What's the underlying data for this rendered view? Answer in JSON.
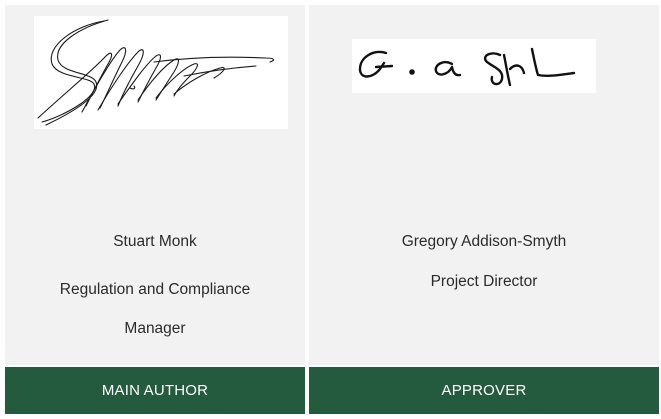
{
  "author": {
    "name": "Stuart Monk",
    "title": "Regulation and Compliance Manager",
    "role_label": "MAIN AUTHOR"
  },
  "approver": {
    "name": "Gregory Addison-Smyth",
    "title": "Project Director",
    "role_label": "APPROVER"
  },
  "colors": {
    "panel_background": "#f2f2f2",
    "footer_background": "#245a3d",
    "footer_text": "#ffffff",
    "body_text": "#2b2b2b"
  }
}
